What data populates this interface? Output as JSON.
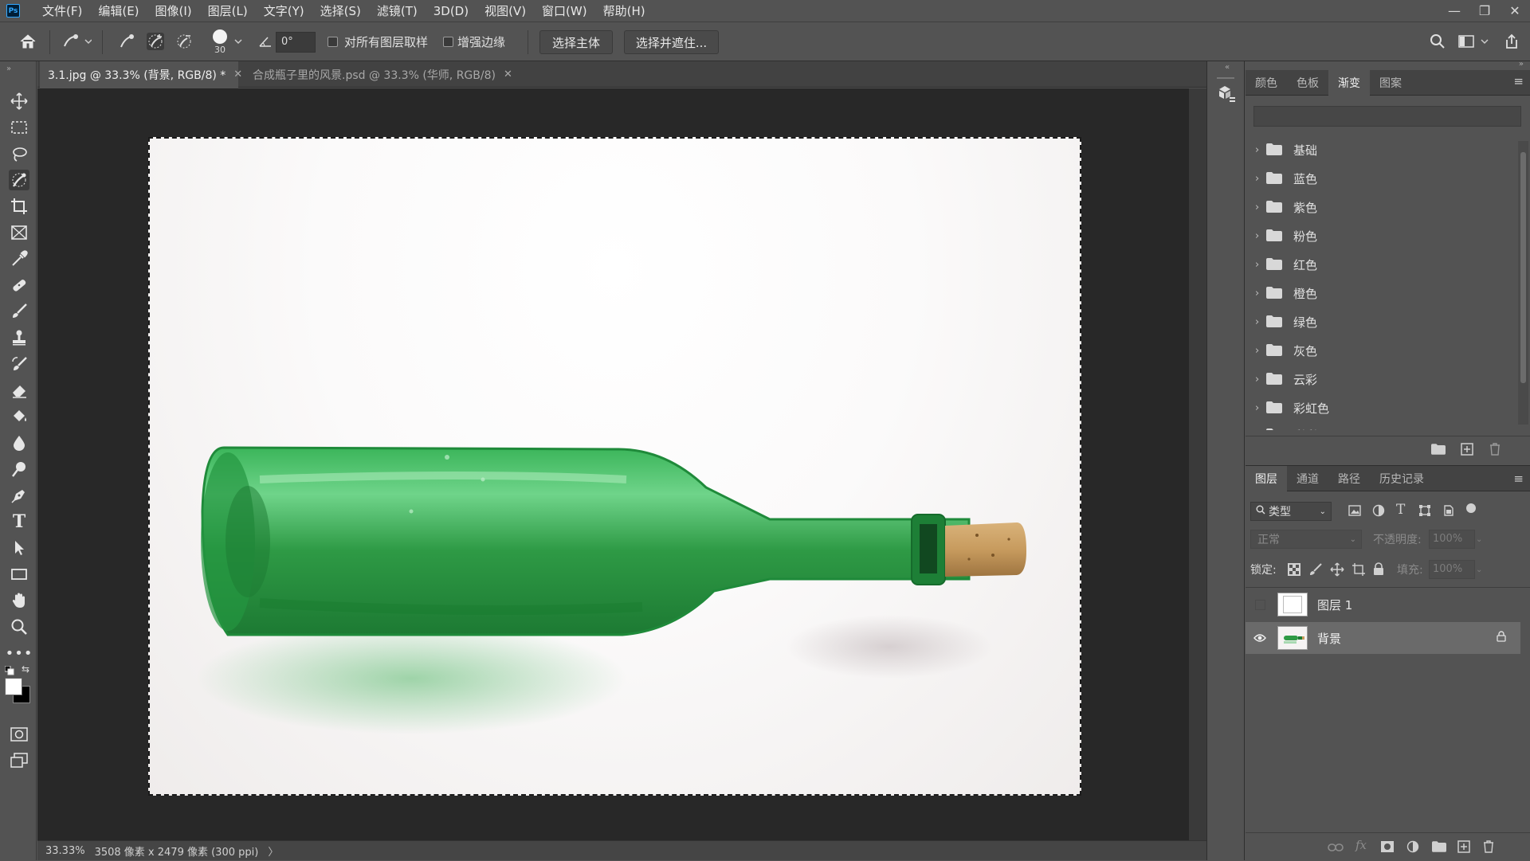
{
  "menu": {
    "app_logo": "Ps",
    "items": [
      "文件(F)",
      "编辑(E)",
      "图像(I)",
      "图层(L)",
      "文字(Y)",
      "选择(S)",
      "滤镜(T)",
      "3D(D)",
      "视图(V)",
      "窗口(W)",
      "帮助(H)"
    ]
  },
  "options": {
    "brush_size": "30",
    "angle_value": "0°",
    "sample_all_layers_label": "对所有图层取样",
    "enhance_edge_label": "增强边缘",
    "select_subject_label": "选择主体",
    "select_and_mask_label": "选择并遮住..."
  },
  "tabs": [
    {
      "label": "3.1.jpg @ 33.3% (背景, RGB/8) *"
    },
    {
      "label": "合成瓶子里的风景.psd @ 33.3% (华师, RGB/8)"
    }
  ],
  "status": {
    "zoom": "33.33%",
    "doc_info": "3508 像素 x 2479 像素 (300 ppi)",
    "arrow": "〉"
  },
  "gradient_panel": {
    "tabs": [
      "颜色",
      "色板",
      "渐变",
      "图案"
    ],
    "active_tab": "渐变",
    "groups": [
      "基础",
      "蓝色",
      "紫色",
      "粉色",
      "红色",
      "橙色",
      "绿色",
      "灰色",
      "云彩",
      "彩虹色",
      "彩彩"
    ]
  },
  "layers_panel": {
    "tabs": [
      "图层",
      "通道",
      "路径",
      "历史记录"
    ],
    "active_tab": "图层",
    "filter_kind": "类型",
    "blend_mode": "正常",
    "opacity_label": "不透明度:",
    "opacity_value": "100%",
    "lock_label": "锁定:",
    "fill_label": "填充:",
    "fill_value": "100%",
    "layers": [
      {
        "name": "图层 1",
        "visible": false,
        "locked": false
      },
      {
        "name": "背景",
        "visible": true,
        "locked": true
      }
    ]
  },
  "colors": {
    "foreground": "#ffffff",
    "background": "#000000",
    "bottle_green": "#2e9a45",
    "accent": "#31a8ff"
  }
}
